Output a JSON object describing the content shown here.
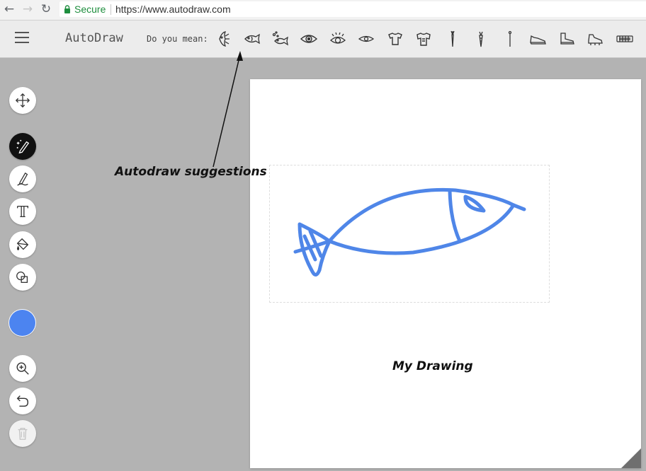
{
  "browser": {
    "secure_label": "Secure",
    "url": "https://www.autodraw.com",
    "secure_color": "#1e8e3e"
  },
  "app": {
    "title": "AutoDraw",
    "suggestions_label": "Do you mean:",
    "suggestions": [
      "angelfish-icon",
      "fish-icon",
      "fish-bubbles-icon",
      "eye-icon",
      "eye-lashes-icon",
      "eye-simple-icon",
      "shirt-icon",
      "jersey-icon",
      "carrot-icon",
      "carrot-icon",
      "pin-icon",
      "sneaker-icon",
      "boot-icon",
      "cleat-icon",
      "keyboard-icon"
    ]
  },
  "toolbar": {
    "tools": [
      "move-tool",
      "autodraw-tool",
      "draw-tool",
      "type-tool",
      "fill-tool",
      "shape-tool",
      "zoom-tool",
      "undo-tool",
      "delete-tool"
    ],
    "active_tool": "autodraw-tool",
    "current_color": "#4c84f0"
  },
  "canvas": {
    "stroke_color": "#4f86e8"
  },
  "annotations": {
    "suggestions": "Autodraw suggestions",
    "drawing": "My Drawing"
  }
}
